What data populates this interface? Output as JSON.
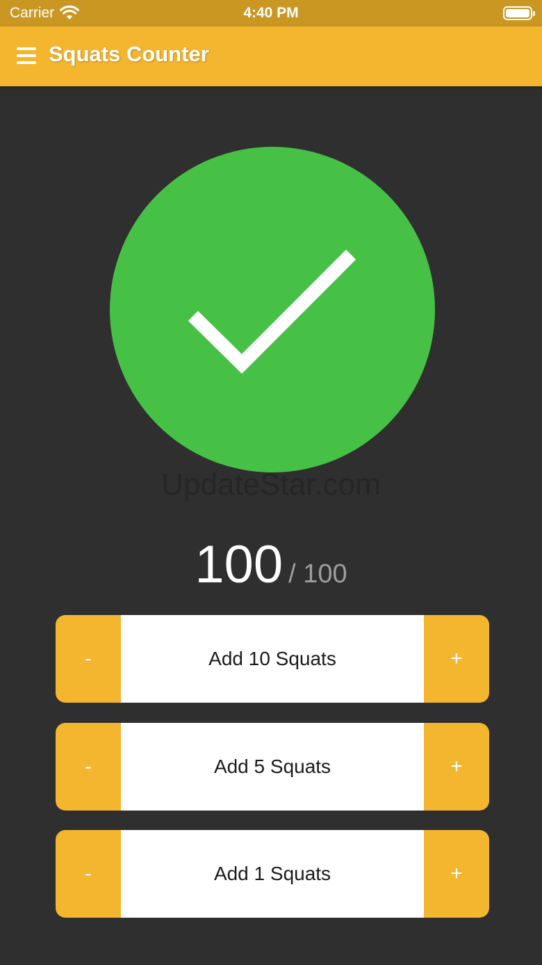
{
  "status_bar": {
    "carrier": "Carrier",
    "time": "4:40 PM"
  },
  "nav": {
    "title": "Squats Counter"
  },
  "completion": {
    "icon": "checkmark-icon",
    "color": "#46c146"
  },
  "watermark": "UpdateStar.com",
  "counter": {
    "count": "100",
    "goal": "/ 100"
  },
  "steps": [
    {
      "label": "Add 10 Squats",
      "minus": "-",
      "plus": "+"
    },
    {
      "label": "Add 5 Squats",
      "minus": "-",
      "plus": "+"
    },
    {
      "label": "Add 1 Squats",
      "minus": "-",
      "plus": "+"
    }
  ],
  "colors": {
    "accent": "#f3b62e",
    "status_bar": "#c99722",
    "background": "#2f2f2f",
    "success": "#46c146"
  }
}
